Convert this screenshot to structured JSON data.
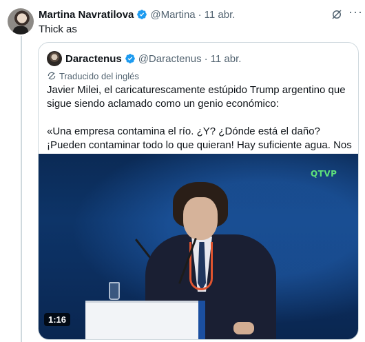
{
  "tweet": {
    "author_name": "Martina Navratilova",
    "handle": "@Martina",
    "separator": "·",
    "date": "11 abr.",
    "text": "Thick as"
  },
  "quoted_tweet": {
    "author_name": "Daractenus",
    "handle": "@Daractenus",
    "separator": "·",
    "date": "11 abr.",
    "translated_label": "Traducido del inglés",
    "paragraph_1": "Javier Milei, el caricaturescamente estúpido Trump argentino que sigue siendo aclamado como un genio económico:",
    "paragraph_2": "«Una empresa contamina el río. ¿Y? ¿Dónde está el daño? ¡Pueden contaminar todo lo que quieran! Hay suficiente agua. Nos ..."
  },
  "video": {
    "duration": "1:16",
    "channel_logo": "QTVP"
  },
  "icons": {
    "verified": "verified-badge-icon",
    "grok": "grok-icon",
    "more": "more-options-icon",
    "translate": "translate-icon"
  },
  "colors": {
    "verified_blue": "#1d9bf0",
    "secondary_text": "#536471",
    "border": "#cfd9de",
    "logo_green": "#5fe37a"
  }
}
